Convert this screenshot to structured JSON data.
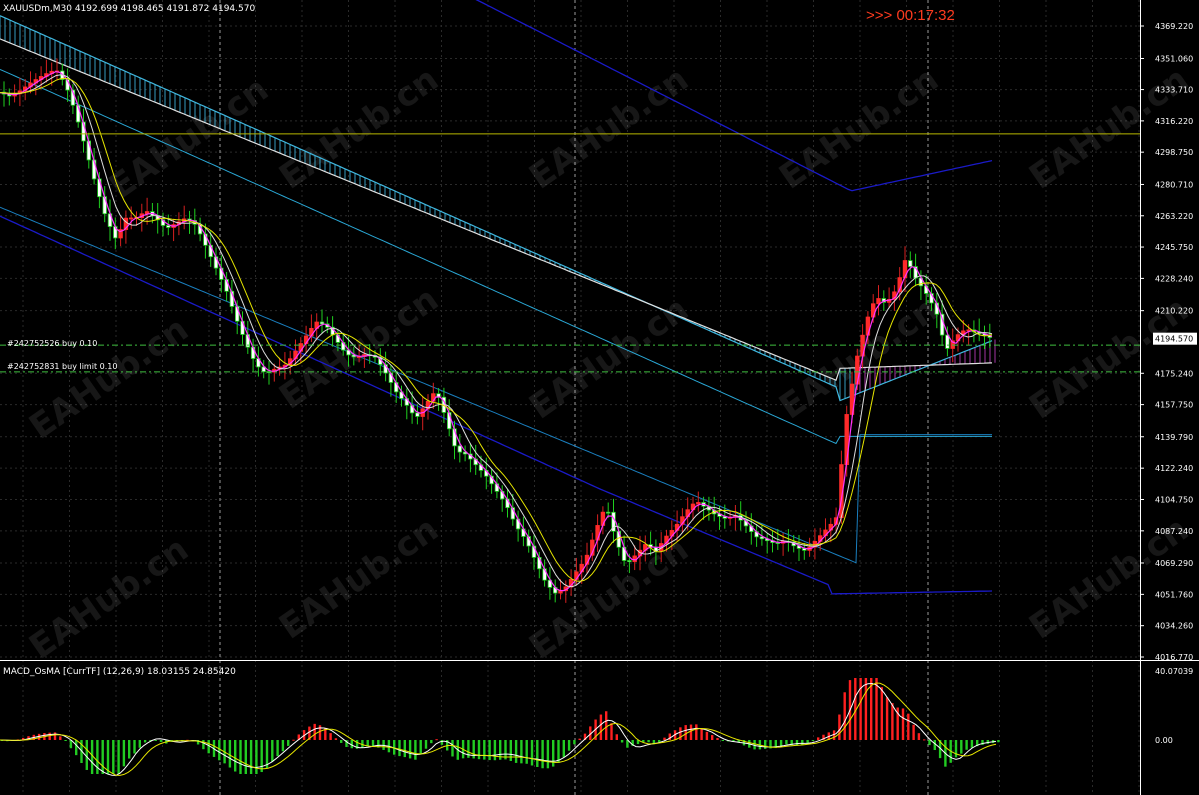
{
  "header": {
    "symbol_line": "XAUUSDm,M30  4192.699 4198.465 4191.872 4194.570",
    "countdown": ">>> 00:17:32"
  },
  "orders": [
    {
      "label": "#242752526 buy 0.10",
      "price": 4191.0,
      "color": "#3fbf3f"
    },
    {
      "label": "#242752831 buy limit 0.10",
      "price": 4176.0,
      "color": "#3fbf3f"
    }
  ],
  "hline": {
    "price": 4309.0,
    "color": "#b8b800"
  },
  "current_price": {
    "label": "4194.570",
    "value": 4194.57
  },
  "price_axis": {
    "ticks": [
      "4369.220",
      "4351.060",
      "4333.710",
      "4316.220",
      "4298.750",
      "4280.710",
      "4263.220",
      "4245.750",
      "4228.240",
      "4210.220",
      "4175.240",
      "4157.750",
      "4139.790",
      "4122.240",
      "4104.750",
      "4087.240",
      "4069.290",
      "4051.760",
      "4034.260",
      "4016.770"
    ],
    "min": 4010.0,
    "max": 4380.0
  },
  "watermark": {
    "text": "EAHub.cn"
  },
  "macd_panel": {
    "title": "MACD_OsMA [CurrTF] (12,26,9) 18.03155 24.85420",
    "ticks": [
      "40.07039",
      "0.00"
    ],
    "colors": {
      "up": "#ff2020",
      "down": "#22cc22",
      "macd": "#ffffff",
      "signal": "#e6e600"
    }
  },
  "chart_data": {
    "type": "candlestick",
    "symbol": "XAUUSDm",
    "timeframe": "M30",
    "ylim": [
      4010,
      4380
    ],
    "colors": {
      "bull": "#ffffff",
      "bear": "#1fd01f",
      "wick": "#888888",
      "sma_fast": "#ff33ff",
      "sma_mid": "#dddddd",
      "sma_slow": "#e6e600",
      "bands": "#2aa8d6",
      "slow_ma": "#1a1ac8",
      "cloud_down": "#40b8e0",
      "cloud_up": "#c040c0"
    },
    "close_path": [
      [
        0,
        4332
      ],
      [
        10,
        4330
      ],
      [
        20,
        4333
      ],
      [
        32,
        4338
      ],
      [
        44,
        4342
      ],
      [
        56,
        4345
      ],
      [
        66,
        4336
      ],
      [
        76,
        4320
      ],
      [
        86,
        4300
      ],
      [
        96,
        4280
      ],
      [
        106,
        4262
      ],
      [
        116,
        4250
      ],
      [
        126,
        4262
      ],
      [
        136,
        4262
      ],
      [
        146,
        4266
      ],
      [
        156,
        4262
      ],
      [
        166,
        4256
      ],
      [
        176,
        4259
      ],
      [
        186,
        4262
      ],
      [
        196,
        4258
      ],
      [
        206,
        4246
      ],
      [
        216,
        4234
      ],
      [
        226,
        4222
      ],
      [
        236,
        4206
      ],
      [
        246,
        4192
      ],
      [
        256,
        4180
      ],
      [
        266,
        4175
      ],
      [
        276,
        4178
      ],
      [
        286,
        4180
      ],
      [
        296,
        4188
      ],
      [
        306,
        4196
      ],
      [
        316,
        4204
      ],
      [
        326,
        4202
      ],
      [
        336,
        4194
      ],
      [
        346,
        4186
      ],
      [
        356,
        4184
      ],
      [
        366,
        4186
      ],
      [
        376,
        4184
      ],
      [
        386,
        4175
      ],
      [
        396,
        4165
      ],
      [
        406,
        4158
      ],
      [
        416,
        4150
      ],
      [
        426,
        4158
      ],
      [
        436,
        4166
      ],
      [
        446,
        4150
      ],
      [
        456,
        4132
      ],
      [
        466,
        4130
      ],
      [
        476,
        4124
      ],
      [
        486,
        4118
      ],
      [
        496,
        4110
      ],
      [
        506,
        4102
      ],
      [
        516,
        4090
      ],
      [
        526,
        4082
      ],
      [
        536,
        4070
      ],
      [
        546,
        4058
      ],
      [
        556,
        4052
      ],
      [
        566,
        4056
      ],
      [
        576,
        4064
      ],
      [
        586,
        4072
      ],
      [
        596,
        4088
      ],
      [
        606,
        4102
      ],
      [
        616,
        4082
      ],
      [
        626,
        4068
      ],
      [
        636,
        4074
      ],
      [
        646,
        4080
      ],
      [
        656,
        4076
      ],
      [
        666,
        4084
      ],
      [
        676,
        4090
      ],
      [
        686,
        4098
      ],
      [
        696,
        4104
      ],
      [
        706,
        4100
      ],
      [
        716,
        4096
      ],
      [
        726,
        4094
      ],
      [
        736,
        4096
      ],
      [
        746,
        4090
      ],
      [
        756,
        4084
      ],
      [
        766,
        4082
      ],
      [
        776,
        4080
      ],
      [
        786,
        4082
      ],
      [
        796,
        4078
      ],
      [
        806,
        4076
      ],
      [
        816,
        4082
      ],
      [
        826,
        4088
      ],
      [
        836,
        4094
      ],
      [
        846,
        4150
      ],
      [
        856,
        4182
      ],
      [
        866,
        4204
      ],
      [
        876,
        4218
      ],
      [
        886,
        4214
      ],
      [
        896,
        4222
      ],
      [
        906,
        4240
      ],
      [
        916,
        4228
      ],
      [
        926,
        4220
      ],
      [
        936,
        4210
      ],
      [
        946,
        4188
      ],
      [
        956,
        4196
      ],
      [
        966,
        4200
      ],
      [
        976,
        4198
      ],
      [
        986,
        4196
      ],
      [
        996,
        4194
      ]
    ]
  }
}
